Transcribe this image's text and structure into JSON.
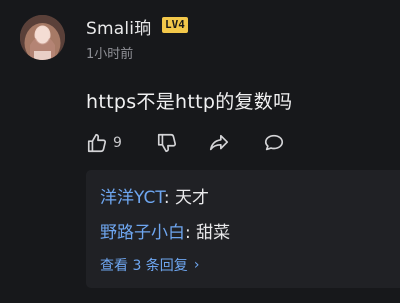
{
  "user": {
    "name": "Smali珦",
    "level": "LV4",
    "time": "1小时前"
  },
  "comment": {
    "text": "https不是http的复数吗",
    "like_count": "9"
  },
  "replies": {
    "items": [
      {
        "author": "洋洋YCT",
        "sep": ": ",
        "text": "天才"
      },
      {
        "author": "野路子小白",
        "sep": ": ",
        "text": "甜菜"
      }
    ],
    "view_more": "查看 3 条回复",
    "view_more_chevron": "›"
  },
  "icons": {
    "like": "thumbs-up-icon",
    "dislike": "thumbs-down-icon",
    "share": "share-arrow-icon",
    "reply": "speech-bubble-icon"
  },
  "colors": {
    "background": "#17181b",
    "reply_panel": "#202125",
    "link_blue": "#6ea6f0",
    "level_badge": "#f3c84a"
  }
}
